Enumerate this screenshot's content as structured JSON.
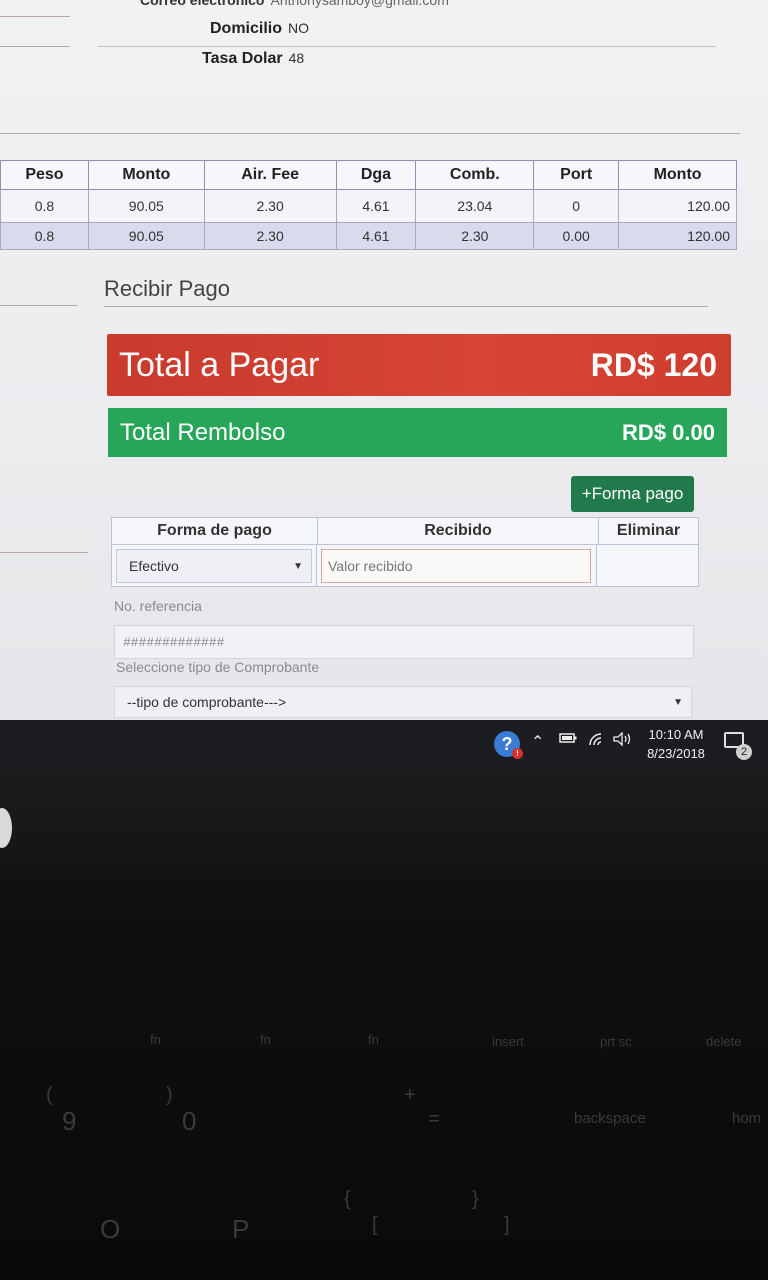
{
  "customer": {
    "email_label": "Correo electronico",
    "email_value": "Anthonysamboy@gmail.com",
    "domicilio_label": "Domicilio",
    "domicilio_value": "NO",
    "tasa_label": "Tasa Dolar",
    "tasa_value": "48"
  },
  "charges": {
    "headers": [
      "Peso",
      "Monto",
      "Air. Fee",
      "Dga",
      "Comb.",
      "Port",
      "Monto"
    ],
    "rows": [
      [
        "0.8",
        "90.05",
        "2.30",
        "4.61",
        "23.04",
        "0",
        "120.00"
      ],
      [
        "0.8",
        "90.05",
        "2.30",
        "4.61",
        "2.30",
        "0.00",
        "120.00"
      ]
    ]
  },
  "payment": {
    "section_title": "Recibir Pago",
    "total_label": "Total a Pagar",
    "total_amount": "RD$ 120",
    "refund_label": "Total Rembolso",
    "refund_amount": "RD$ 0.00",
    "add_button": "+Forma pago",
    "table_headers": [
      "Forma de pago",
      "Recibido",
      "Eliminar"
    ],
    "method_selected": "Efectivo",
    "received_placeholder": "Valor recibido",
    "reference_label": "No. referencia",
    "reference_placeholder": "#############",
    "voucher_label": "Seleccione tipo de Comprobante",
    "voucher_selected": "--tipo de comprobante--->"
  },
  "colors": {
    "total_bg": "#d3402f",
    "refund_bg": "#27a65a",
    "add_button_bg": "#217a4c"
  },
  "taskbar": {
    "time": "10:10 AM",
    "date": "8/23/2018",
    "notification_count": "2",
    "icons": [
      "help-icon",
      "chevron-up-icon",
      "battery-icon",
      "wifi-icon",
      "volume-icon"
    ]
  },
  "keyboard": {
    "row1": [
      "fn",
      "fn",
      "fn",
      "fn",
      "insert",
      "prt sc",
      "delete"
    ],
    "row2": [
      "(",
      "9",
      ")",
      "0",
      "—",
      "-",
      "+",
      "=",
      "←",
      "backspace",
      "hom"
    ],
    "row3": [
      "O",
      "P",
      "{",
      "[",
      "}",
      "]",
      "|",
      "\\"
    ]
  }
}
